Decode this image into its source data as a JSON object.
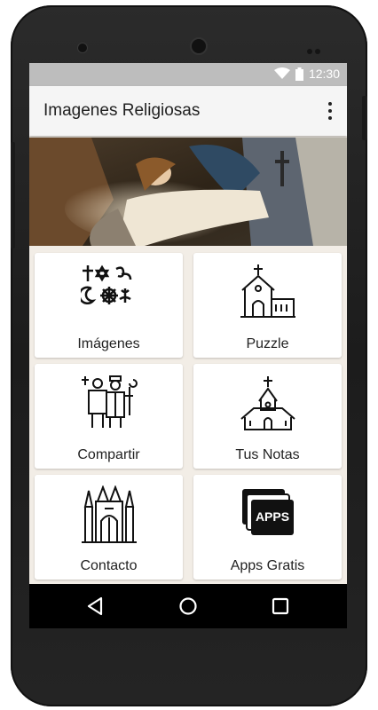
{
  "status": {
    "time": "12:30",
    "icons": [
      "wifi-icon",
      "battery-icon"
    ]
  },
  "appbar": {
    "title": "Imagenes Religiosas",
    "menu_icon": "more-vert-icon"
  },
  "banner": {
    "description_icon": "religious-painting"
  },
  "tiles": [
    {
      "label": "Imágenes",
      "icon": "religion-symbols-icon"
    },
    {
      "label": "Puzzle",
      "icon": "church-icon"
    },
    {
      "label": "Compartir",
      "icon": "clergy-people-icon"
    },
    {
      "label": "Tus Notas",
      "icon": "chapel-icon"
    },
    {
      "label": "Contacto",
      "icon": "cathedral-icon"
    },
    {
      "label": "Apps Gratis",
      "icon": "apps-stack-icon"
    }
  ],
  "tile_apps_text": "APPS",
  "navbar": {
    "icons": [
      "back-icon",
      "home-icon",
      "recents-icon"
    ]
  },
  "colors": {
    "statusbar": "#bdbdbd",
    "appbar": "#f5f5f5",
    "navbar": "#000000",
    "background": "#f2ede6"
  }
}
